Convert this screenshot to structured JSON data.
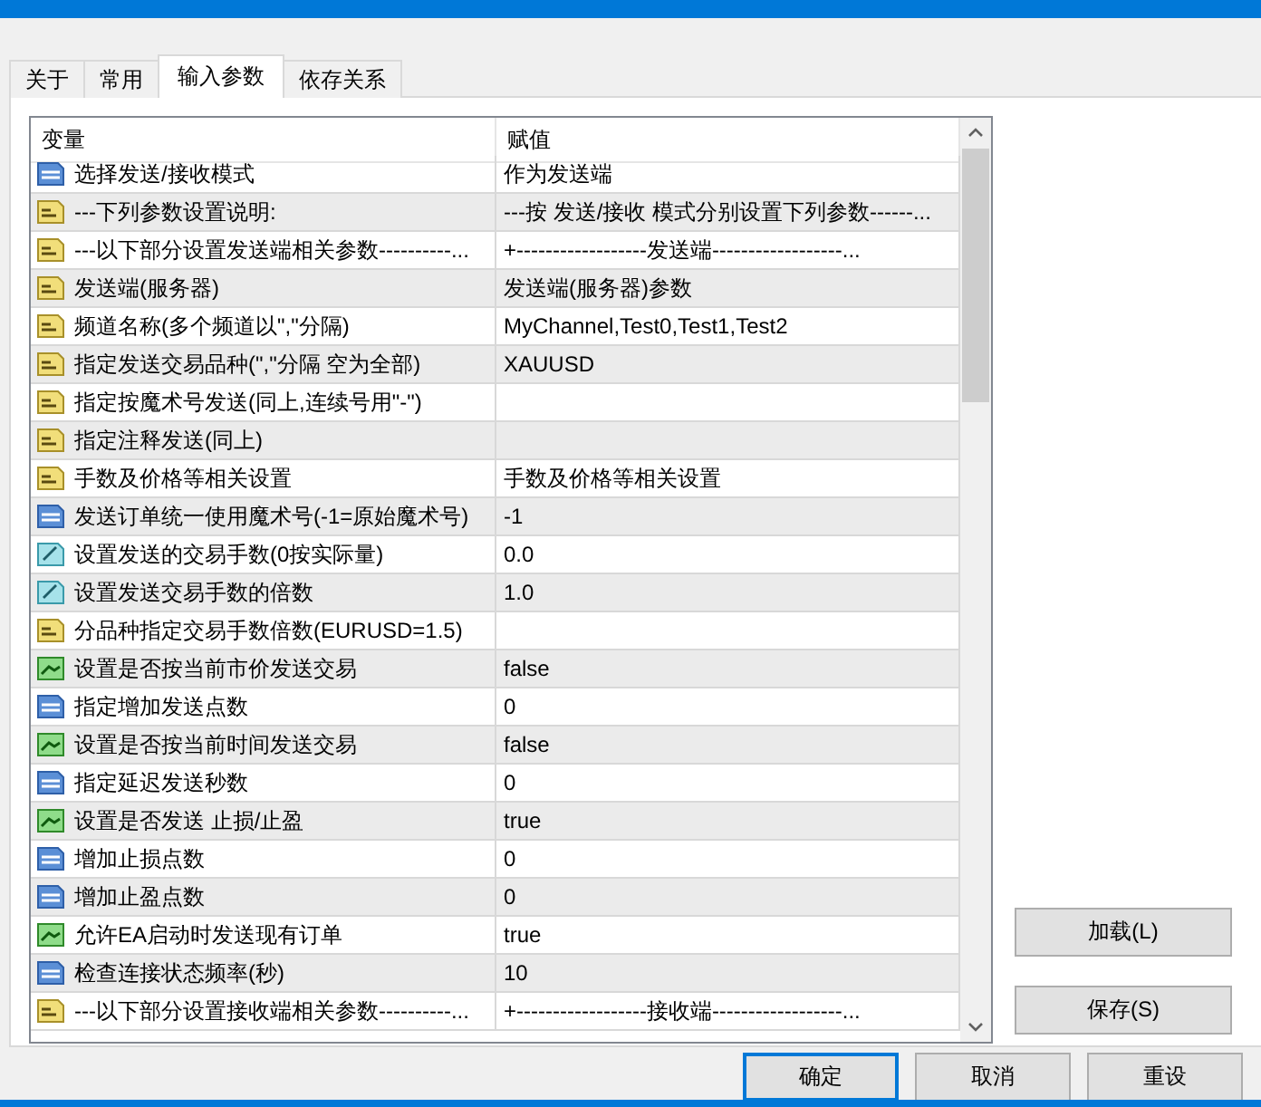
{
  "tabs": [
    {
      "label": "关于",
      "selected": false
    },
    {
      "label": "常用",
      "selected": false
    },
    {
      "label": "输入参数",
      "selected": true
    },
    {
      "label": "依存关系",
      "selected": false
    }
  ],
  "table": {
    "columns": [
      "变量",
      "赋值"
    ],
    "rows": [
      {
        "kind": "int",
        "variable": "选择发送/接收模式",
        "value": "作为发送端"
      },
      {
        "kind": "string",
        "variable": "---下列参数设置说明:",
        "value": "---按 发送/接收 模式分别设置下列参数------..."
      },
      {
        "kind": "string",
        "variable": "---以下部分设置发送端相关参数----------...",
        "value": "+------------------发送端------------------..."
      },
      {
        "kind": "string",
        "variable": "发送端(服务器)",
        "value": "发送端(服务器)参数"
      },
      {
        "kind": "string",
        "variable": "频道名称(多个频道以\",\"分隔)",
        "value": "MyChannel,Test0,Test1,Test2"
      },
      {
        "kind": "string",
        "variable": "指定发送交易品种(\",\"分隔 空为全部)",
        "value": "XAUUSD"
      },
      {
        "kind": "string",
        "variable": "指定按魔术号发送(同上,连续号用\"-\")"
      },
      {
        "kind": "string",
        "variable": "指定注释发送(同上)"
      },
      {
        "kind": "string",
        "variable": "手数及价格等相关设置",
        "value": "手数及价格等相关设置"
      },
      {
        "kind": "int",
        "variable": "发送订单统一使用魔术号(-1=原始魔术号)",
        "value": "-1"
      },
      {
        "kind": "double",
        "variable": "设置发送的交易手数(0按实际量)",
        "value": "0.0"
      },
      {
        "kind": "double",
        "variable": "设置发送交易手数的倍数",
        "value": "1.0"
      },
      {
        "kind": "string",
        "variable": "分品种指定交易手数倍数(EURUSD=1.5)"
      },
      {
        "kind": "bool",
        "variable": "设置是否按当前市价发送交易",
        "value": "false"
      },
      {
        "kind": "int",
        "variable": "指定增加发送点数",
        "value": "0"
      },
      {
        "kind": "bool",
        "variable": "设置是否按当前时间发送交易",
        "value": "false"
      },
      {
        "kind": "int",
        "variable": "指定延迟发送秒数",
        "value": "0"
      },
      {
        "kind": "bool",
        "variable": "设置是否发送 止损/止盈",
        "value": "true"
      },
      {
        "kind": "int",
        "variable": "增加止损点数",
        "value": "0"
      },
      {
        "kind": "int",
        "variable": "增加止盈点数",
        "value": "0"
      },
      {
        "kind": "bool",
        "variable": "允许EA启动时发送现有订单",
        "value": "true"
      },
      {
        "kind": "int",
        "variable": "检查连接状态频率(秒)",
        "value": "10"
      },
      {
        "kind": "string",
        "variable": "---以下部分设置接收端相关参数----------...",
        "value": "+------------------接收端------------------..."
      }
    ]
  },
  "side_buttons": [
    "加载(L)",
    "保存(S)"
  ],
  "buttons": [
    {
      "label": "确定",
      "focused": true
    },
    {
      "label": "取消",
      "focused": false
    },
    {
      "label": "重设",
      "focused": false
    }
  ]
}
